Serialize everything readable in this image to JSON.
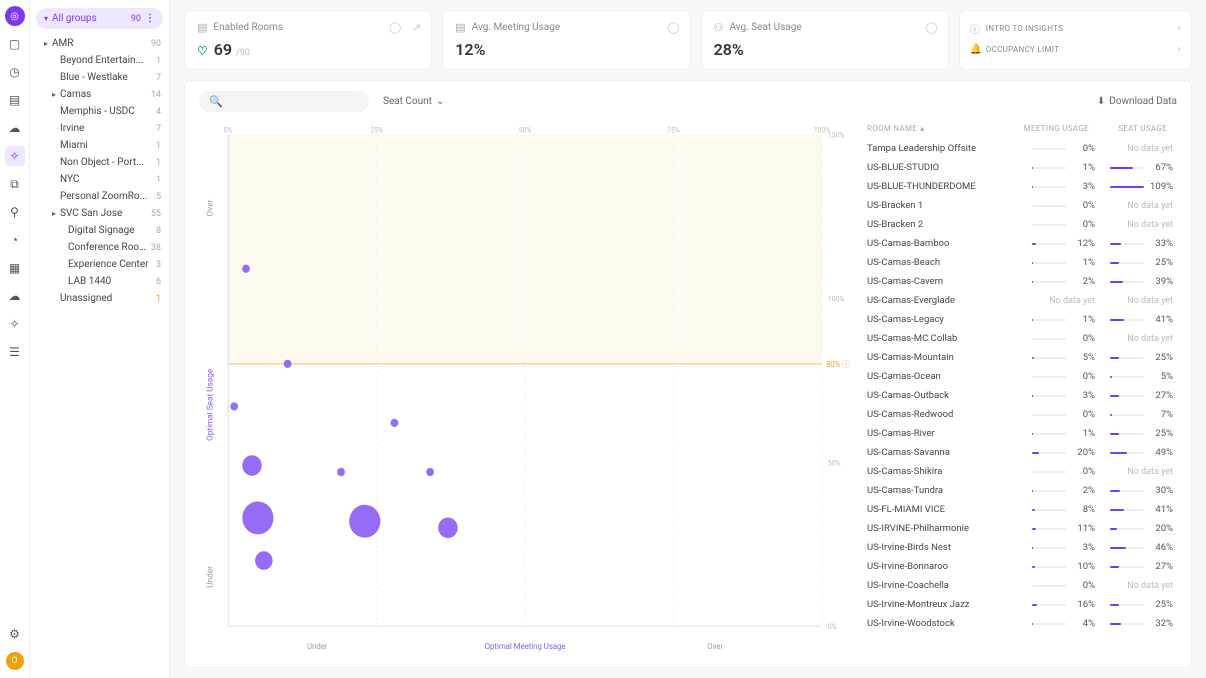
{
  "sidebar": {
    "all_groups_label": "All groups",
    "all_groups_count": "90",
    "tree": [
      {
        "label": "AMR",
        "count": "90",
        "caret": true,
        "level": 1,
        "children": [
          {
            "label": "Beyond Entertain...",
            "count": "1",
            "level": 2
          },
          {
            "label": "Blue - Westlake",
            "count": "7",
            "level": 2
          },
          {
            "label": "Camas",
            "count": "14",
            "caret": true,
            "level": 2
          },
          {
            "label": "Memphis - USDC",
            "count": "4",
            "level": 2
          },
          {
            "label": "Irvine",
            "count": "7",
            "level": 2
          },
          {
            "label": "Miami",
            "count": "1",
            "level": 2
          },
          {
            "label": "Non Object - Port...",
            "count": "1",
            "level": 2
          },
          {
            "label": "NYC",
            "count": "1",
            "level": 2
          },
          {
            "label": "Personal ZoomRo...",
            "count": "5",
            "level": 2
          },
          {
            "label": "SVC San Jose",
            "count": "55",
            "caret": true,
            "level": 2,
            "children": [
              {
                "label": "Digital Signage",
                "count": "8",
                "level": 3
              },
              {
                "label": "Conference Roo...",
                "count": "38",
                "level": 3
              },
              {
                "label": "Experience Center",
                "count": "3",
                "level": 3
              },
              {
                "label": "LAB 1440",
                "count": "6",
                "level": 3
              }
            ]
          },
          {
            "label": "Unassigned",
            "count": "1",
            "level": 2,
            "warn": true
          }
        ]
      }
    ]
  },
  "cards": {
    "enabled": {
      "title": "Enabled Rooms",
      "value": "69",
      "sub": "/90"
    },
    "meeting": {
      "title": "Avg. Meeting Usage",
      "value": "12%"
    },
    "seat": {
      "title": "Avg. Seat Usage",
      "value": "28%"
    },
    "insights": [
      {
        "icon": "ⓘ",
        "label": "INTRO TO INSIGHTS"
      },
      {
        "icon": "🔔",
        "label": "OCCUPANCY LIMIT"
      }
    ]
  },
  "panel": {
    "filter": "Seat Count",
    "download": "Download Data",
    "x_ticks": [
      "0%",
      "25%",
      "50%",
      "75%",
      "100%"
    ],
    "y_ticks_right": [
      "150%",
      "100%",
      "50%",
      "0%"
    ],
    "y_80_label": "80%",
    "x_bottom": [
      "Under",
      "Optimal Meeting Usage",
      "Over"
    ],
    "y_left": [
      "Over",
      "Optimal Seat Usage",
      "Under"
    ]
  },
  "table": {
    "headers": {
      "name": "ROOM NAME",
      "mu": "MEETING USAGE",
      "su": "SEAT USAGE"
    },
    "rows": [
      {
        "name": "Tampa Leadership Offsite",
        "mu": 0,
        "su": null
      },
      {
        "name": "US-BLUE-STUDIO",
        "mu": 1,
        "su": 67
      },
      {
        "name": "US-BLUE-THUNDERDOME",
        "mu": 3,
        "su": 109
      },
      {
        "name": "US-Bracken 1",
        "mu": 0,
        "su": null
      },
      {
        "name": "US-Bracken 2",
        "mu": 0,
        "su": null
      },
      {
        "name": "US-Camas-Bamboo",
        "mu": 12,
        "su": 33
      },
      {
        "name": "US-Camas-Beach",
        "mu": 1,
        "su": 25
      },
      {
        "name": "US-Camas-Cavern",
        "mu": 2,
        "su": 39
      },
      {
        "name": "US-Camas-Everglade",
        "mu": null,
        "su": null
      },
      {
        "name": "US-Camas-Legacy",
        "mu": 1,
        "su": 41
      },
      {
        "name": "US-Camas-MC Collab",
        "mu": 0,
        "su": null
      },
      {
        "name": "US-Camas-Mountain",
        "mu": 5,
        "su": 25
      },
      {
        "name": "US-Camas-Ocean",
        "mu": 0,
        "su": 5
      },
      {
        "name": "US-Camas-Outback",
        "mu": 3,
        "su": 27
      },
      {
        "name": "US-Camas-Redwood",
        "mu": 0,
        "su": 7
      },
      {
        "name": "US-Camas-River",
        "mu": 1,
        "su": 25
      },
      {
        "name": "US-Camas-Savanna",
        "mu": 20,
        "su": 49
      },
      {
        "name": "US-Camas-Shikira",
        "mu": 0,
        "su": null
      },
      {
        "name": "US-Camas-Tundra",
        "mu": 2,
        "su": 30
      },
      {
        "name": "US-FL-MIAMI VICE",
        "mu": 8,
        "su": 41
      },
      {
        "name": "US-IRVINE-Philharmonie",
        "mu": 11,
        "su": 20
      },
      {
        "name": "US-Irvine-Birds Nest",
        "mu": 3,
        "su": 46
      },
      {
        "name": "US-Irvine-Bonnaroo",
        "mu": 10,
        "su": 27
      },
      {
        "name": "US-Irvine-Coachella",
        "mu": 0,
        "su": null
      },
      {
        "name": "US-Irvine-Montreux Jazz",
        "mu": 16,
        "su": 25
      },
      {
        "name": "US-Irvine-Woodstock",
        "mu": 4,
        "su": 32
      }
    ],
    "no_data_label": "No data yet"
  },
  "chart_data": {
    "type": "scatter",
    "xlabel": "Meeting Usage (%)",
    "ylabel": "Seat Usage (%)",
    "size_var": "Seat Count",
    "xlim": [
      0,
      100
    ],
    "ylim": [
      0,
      150
    ],
    "hband_80": 80,
    "points": [
      {
        "x": 3,
        "y": 109,
        "r": 4
      },
      {
        "x": 10,
        "y": 80,
        "r": 4
      },
      {
        "x": 1,
        "y": 67,
        "r": 4
      },
      {
        "x": 28,
        "y": 62,
        "r": 4
      },
      {
        "x": 4,
        "y": 49,
        "r": 10
      },
      {
        "x": 19,
        "y": 47,
        "r": 4
      },
      {
        "x": 34,
        "y": 47,
        "r": 4
      },
      {
        "x": 5,
        "y": 33,
        "r": 16
      },
      {
        "x": 23,
        "y": 32,
        "r": 16
      },
      {
        "x": 37,
        "y": 30,
        "r": 10
      },
      {
        "x": 6,
        "y": 20,
        "r": 9
      }
    ]
  }
}
